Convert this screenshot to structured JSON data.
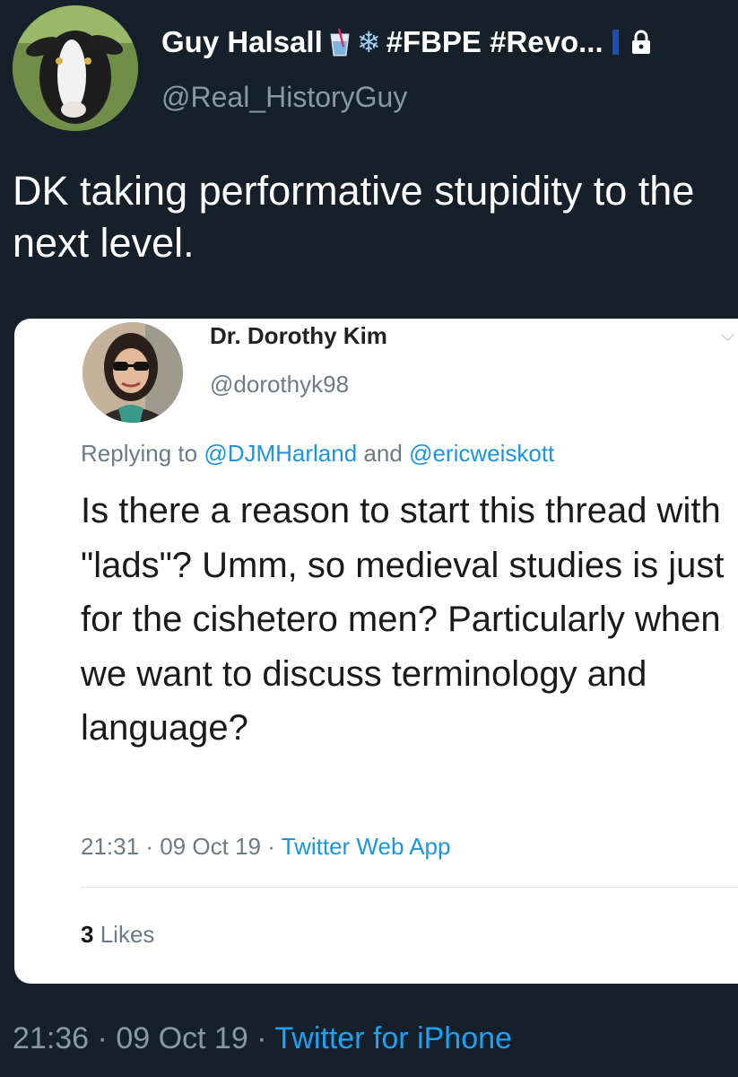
{
  "outer_tweet": {
    "author_name": "Guy Halsall",
    "author_badges": "#FBPE #Revo...",
    "author_handle": "@Real_HistoryGuy",
    "text": "DK taking performative stupidity to the next level.",
    "time": "21:36",
    "date": "09 Oct 19",
    "source": "Twitter for iPhone",
    "separator": "·"
  },
  "quoted_tweet": {
    "author_name": "Dr. Dorothy Kim",
    "author_handle": "@dorothyk98",
    "replying_prefix": "Replying to",
    "reply_mention_1": "@DJMHarland",
    "reply_conjunction": "and",
    "reply_mention_2": "@ericweiskott",
    "text": "Is there a reason to start this thread with \"lads\"? Umm, so medieval studies is just for the cishetero men? Particularly when we want to discuss terminology and language?",
    "time": "21:31",
    "date": "09 Oct 19",
    "source": "Twitter Web App",
    "separator": "·",
    "likes_count": "3",
    "likes_label": "Likes"
  },
  "icons": {
    "glass": "tropical-drink-icon",
    "snowflake": "snowflake-icon",
    "lock": "lock-icon",
    "chevron": "chevron-down-icon"
  },
  "colors": {
    "background": "#15202b",
    "link_dark": "#1da1f2",
    "link_light": "#1b95e0",
    "muted_dark": "#8899a6"
  }
}
